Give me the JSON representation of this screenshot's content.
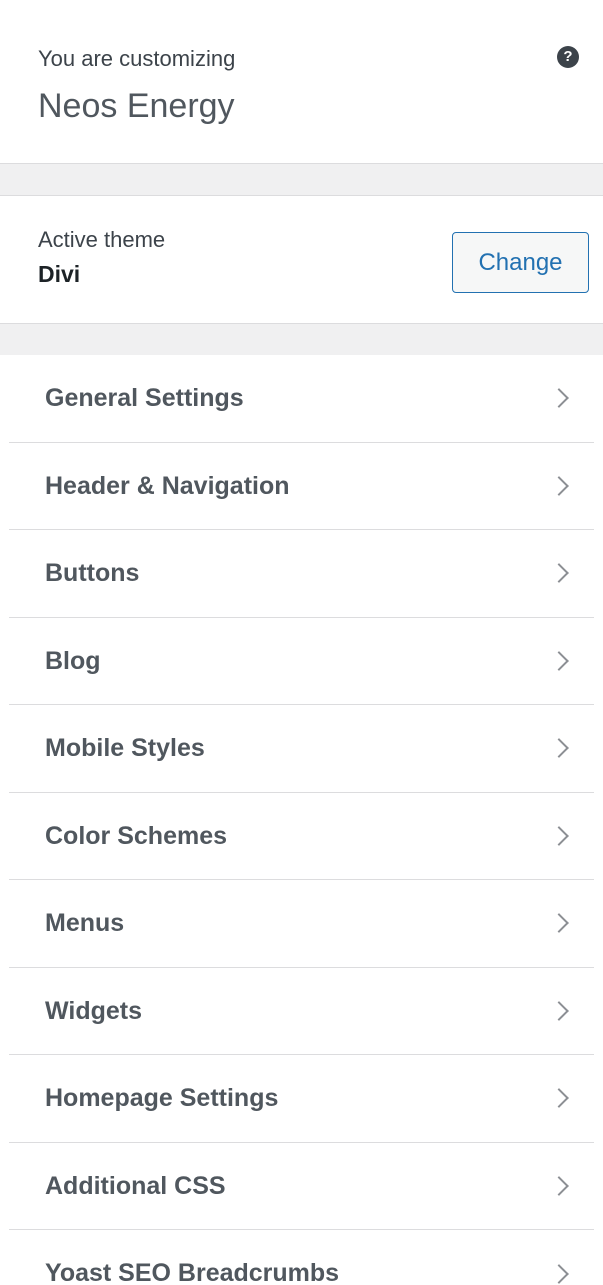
{
  "header": {
    "customizing_label": "You are customizing",
    "site_title": "Neos Energy",
    "help_icon": "?"
  },
  "theme": {
    "label": "Active theme",
    "name": "Divi",
    "change_label": "Change"
  },
  "menu": {
    "items": [
      {
        "label": "General Settings"
      },
      {
        "label": "Header & Navigation"
      },
      {
        "label": "Buttons"
      },
      {
        "label": "Blog"
      },
      {
        "label": "Mobile Styles"
      },
      {
        "label": "Color Schemes"
      },
      {
        "label": "Menus"
      },
      {
        "label": "Widgets"
      },
      {
        "label": "Homepage Settings"
      },
      {
        "label": "Additional CSS"
      },
      {
        "label": "Yoast SEO Breadcrumbs"
      }
    ]
  },
  "colors": {
    "accent": "#2271b1",
    "separator_bg": "#f0f0f1",
    "text_muted": "#50575e"
  }
}
